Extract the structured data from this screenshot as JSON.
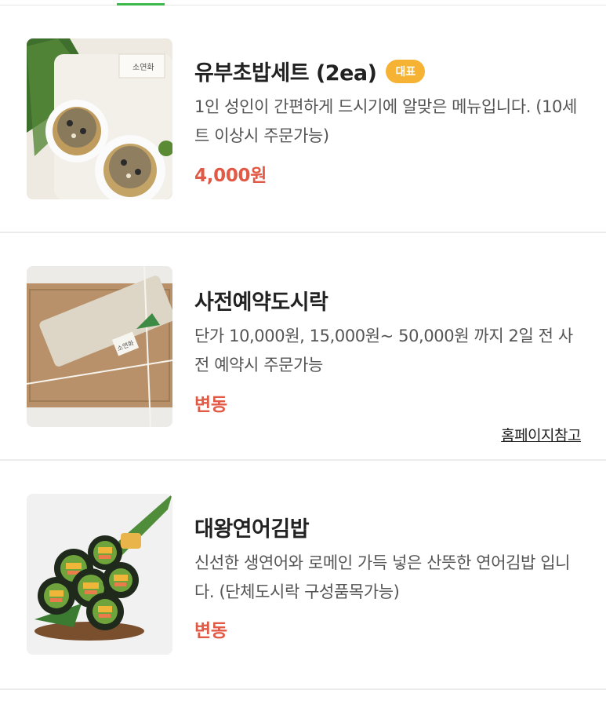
{
  "colors": {
    "accent_green": "#3cb94a",
    "price_red": "#e15a46",
    "badge_orange": "#f6b233"
  },
  "menu_items": [
    {
      "name": "유부초밥세트 (2ea)",
      "badge": "대표",
      "description": "1인 성인이 간편하게 드시기에 알맞은 메뉴입니다. (10세트 이상시 주문가능)",
      "price": "4,000원",
      "image_icon": "inari-sushi-photo",
      "image_label": "소연화"
    },
    {
      "name": "사전예약도시락",
      "description": "단가 10,000원, 15,000원~ 50,000원 까지 2일 전 사전 예약시 주문가능",
      "price": "변동",
      "link": "홈페이지참고",
      "image_icon": "lunchbox-photo",
      "image_label": "소연화"
    },
    {
      "name": "대왕연어김밥",
      "description": "신선한 생연어와 로메인 가득 넣은 산뜻한 연어김밥 입니다. (단체도시락 구성품목가능)",
      "price": "변동",
      "image_icon": "salmon-gimbap-photo"
    }
  ]
}
